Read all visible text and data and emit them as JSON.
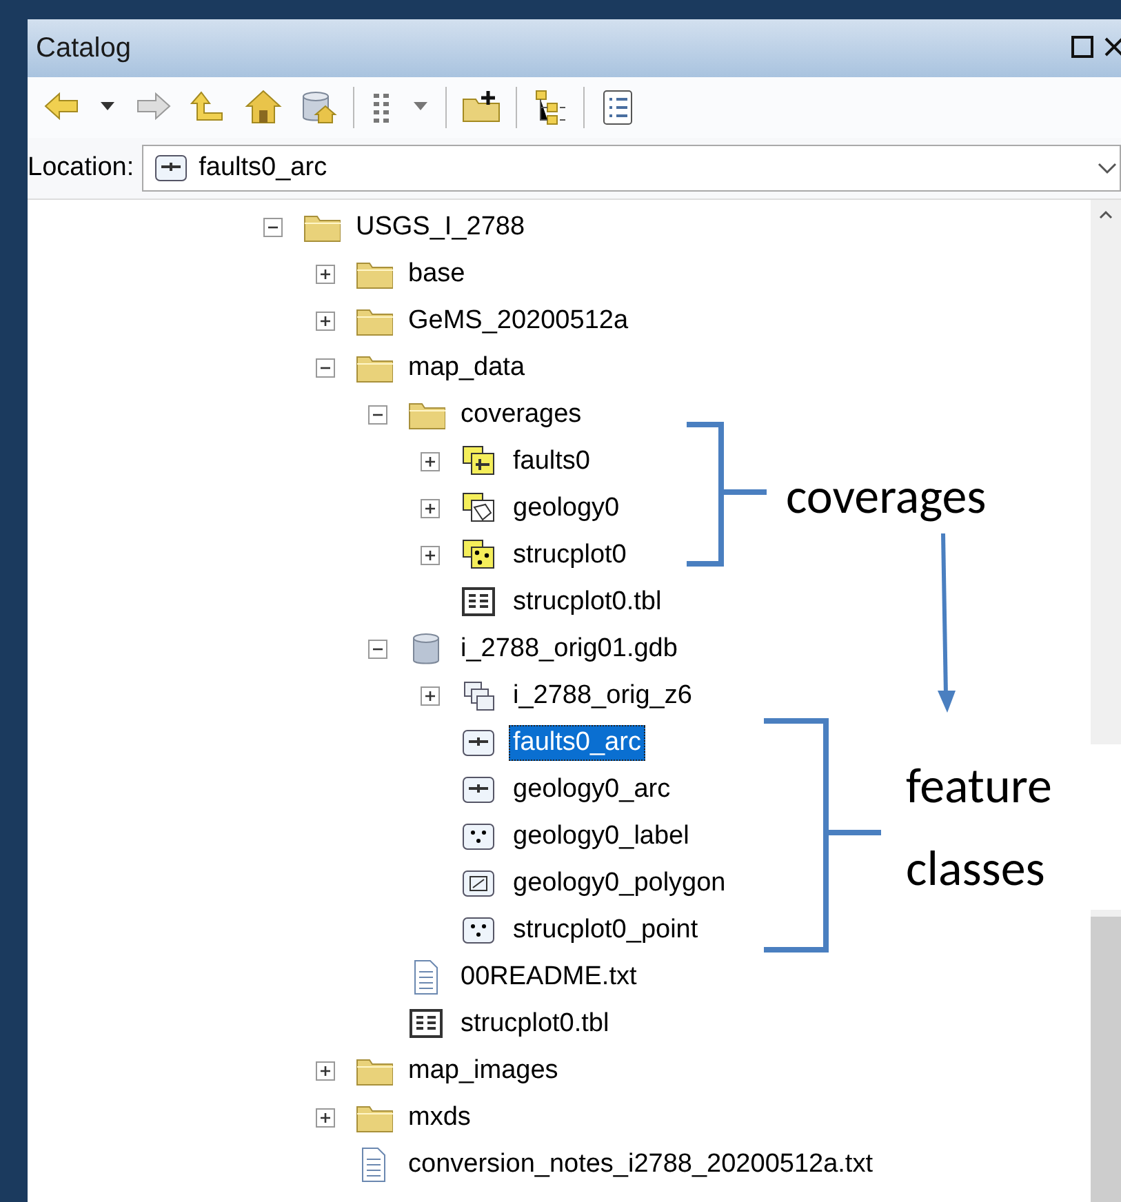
{
  "window": {
    "title": "Catalog"
  },
  "location": {
    "label": "Location:",
    "value": "faults0_arc",
    "kind": "line-fc"
  },
  "tree": [
    {
      "label": "USGS_I_2788",
      "kind": "folder",
      "expanded": true,
      "selected": false,
      "children": [
        {
          "label": "base",
          "kind": "folder",
          "expanded": false,
          "selected": false
        },
        {
          "label": "GeMS_20200512a",
          "kind": "folder",
          "expanded": false,
          "selected": false
        },
        {
          "label": "map_data",
          "kind": "folder",
          "expanded": true,
          "selected": false,
          "children": [
            {
              "label": "coverages",
              "kind": "folder",
              "expanded": true,
              "selected": false,
              "children": [
                {
                  "label": "faults0",
                  "kind": "coverage-line",
                  "expanded": false,
                  "selected": false
                },
                {
                  "label": "geology0",
                  "kind": "coverage-poly",
                  "expanded": false,
                  "selected": false
                },
                {
                  "label": "strucplot0",
                  "kind": "coverage-point",
                  "expanded": false,
                  "selected": false
                },
                {
                  "label": "strucplot0.tbl",
                  "kind": "table",
                  "selected": false
                }
              ]
            },
            {
              "label": "i_2788_orig01.gdb",
              "kind": "database",
              "expanded": true,
              "selected": false,
              "children": [
                {
                  "label": "i_2788_orig_z6",
                  "kind": "dataset",
                  "expanded": false,
                  "selected": false
                },
                {
                  "label": "faults0_arc",
                  "kind": "line-fc",
                  "selected": true
                },
                {
                  "label": "geology0_arc",
                  "kind": "line-fc",
                  "selected": false
                },
                {
                  "label": "geology0_label",
                  "kind": "point-fc",
                  "selected": false
                },
                {
                  "label": "geology0_polygon",
                  "kind": "polygon-fc",
                  "selected": false
                },
                {
                  "label": "strucplot0_point",
                  "kind": "point-fc",
                  "selected": false
                }
              ]
            },
            {
              "label": "00README.txt",
              "kind": "text-file",
              "selected": false
            },
            {
              "label": "strucplot0.tbl",
              "kind": "table",
              "selected": false
            }
          ]
        },
        {
          "label": "map_images",
          "kind": "folder",
          "expanded": false,
          "selected": false
        },
        {
          "label": "mxds",
          "kind": "folder",
          "expanded": false,
          "selected": false
        },
        {
          "label": "conversion_notes_i2788_20200512a.txt",
          "kind": "text-file",
          "selected": false
        }
      ]
    }
  ],
  "annotations": [
    {
      "label": "coverages"
    },
    {
      "label": "feature classes"
    }
  ]
}
